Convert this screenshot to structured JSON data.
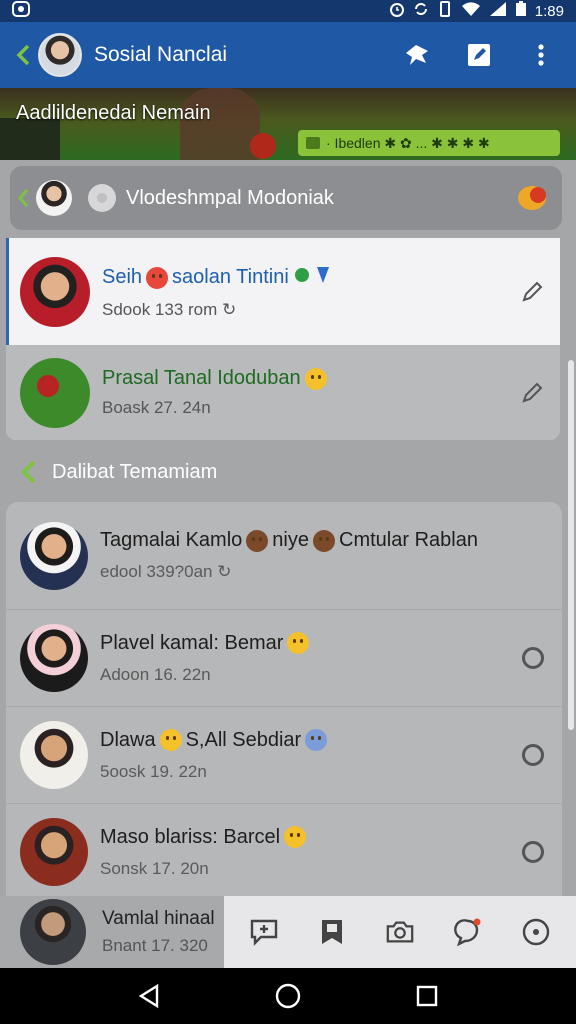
{
  "status_bar": {
    "time": "1:89",
    "left_icon": "app-notification-icon",
    "right_icons": [
      "alarm-icon",
      "sync-icon",
      "vibrate-icon",
      "wifi-icon",
      "signal-icon",
      "battery-icon"
    ]
  },
  "app_bar": {
    "title": "Sosial Nanclai",
    "actions": [
      "pin-icon",
      "compose-icon",
      "more-vert-icon"
    ]
  },
  "banner": {
    "title": "Aadlildenedai Nemain",
    "pill_text": "· Ibedlen ✱ ✿ ... ✱ ✱ ✱ ✱"
  },
  "search": {
    "text": "Vlodeshmpal Modoniak"
  },
  "pinned": [
    {
      "name": "Seih",
      "name_rest": "saolan Tintini",
      "sub": "Sdook 133 rom",
      "sub_icon": "↻"
    },
    {
      "name": "Prasal Tanal Idoduban",
      "sub": "Boask 27. 24n"
    }
  ],
  "section": {
    "title": "Dalibat Temamiam"
  },
  "chats": [
    {
      "name_a": "Tagmalai Kamlo",
      "name_b": "niye",
      "name_c": "Cmtular Rablan",
      "sub": "edool 339?0an",
      "sub_icon": "↻"
    },
    {
      "name": "Plavel kamal: Bemar",
      "sub": "Adoon 16. 22n"
    },
    {
      "name_a": "Dlawa",
      "name_b": "S,All Sebdiar",
      "sub": "5oosk 19. 22n"
    },
    {
      "name": "Maso blariss: Barcel",
      "sub": "Sonsk 17. 20n"
    }
  ],
  "bottom_contact": {
    "name": "Vamlal hinaal",
    "sub": "Bnant 17. 320"
  },
  "toolbar_icons": [
    "chat-add-icon",
    "bookmark-icon",
    "camera-icon",
    "notification-bell-icon",
    "status-circle-icon"
  ],
  "nav_icons": [
    "back-triangle-icon",
    "home-circle-icon",
    "recents-square-icon"
  ],
  "colors": {
    "app_bar": "#1f58a4",
    "status_bar": "#14386e",
    "accent_blue": "#2d65b6",
    "accent_green": "#1f6a22",
    "pill_green": "#8ac23a"
  }
}
